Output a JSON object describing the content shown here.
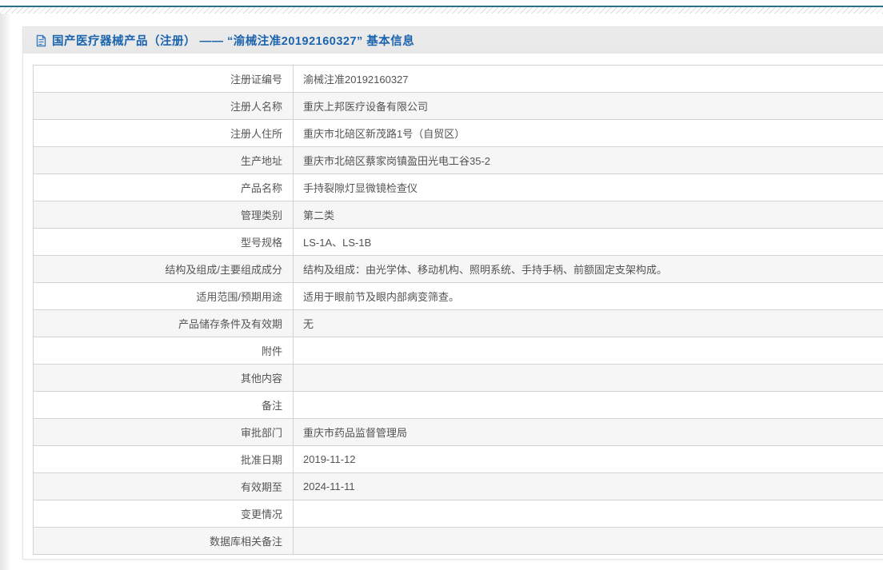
{
  "header": {
    "title": "国产医疗器械产品（注册） —— “渝械注准20192160327” 基本信息",
    "icon": "document-icon"
  },
  "colors": {
    "top_rule": "#2b6e8a",
    "title_blue": "#1b64ae",
    "header_bg": "#e9e9e9",
    "row_stripe": "#f6f6f6",
    "table_border": "#d4d4d4",
    "text": "#555555"
  },
  "table": {
    "rows": [
      {
        "label": "注册证编号",
        "value": "渝械注准20192160327"
      },
      {
        "label": "注册人名称",
        "value": "重庆上邦医疗设备有限公司"
      },
      {
        "label": "注册人住所",
        "value": "重庆市北碚区新茂路1号（自贸区）"
      },
      {
        "label": "生产地址",
        "value": "重庆市北碚区蔡家岗镇盈田光电工谷35-2"
      },
      {
        "label": "产品名称",
        "value": "手持裂隙灯显微镜检查仪"
      },
      {
        "label": "管理类别",
        "value": "第二类"
      },
      {
        "label": "型号规格",
        "value": "LS-1A、LS-1B"
      },
      {
        "label": "结构及组成/主要组成成分",
        "value": "结构及组成：由光学体、移动机构、照明系统、手持手柄、前额固定支架构成。"
      },
      {
        "label": "适用范围/预期用途",
        "value": "适用于眼前节及眼内部病变筛查。"
      },
      {
        "label": "产品储存条件及有效期",
        "value": "无"
      },
      {
        "label": "附件",
        "value": ""
      },
      {
        "label": "其他内容",
        "value": ""
      },
      {
        "label": "备注",
        "value": ""
      },
      {
        "label": "审批部门",
        "value": "重庆市药品监督管理局"
      },
      {
        "label": "批准日期",
        "value": "2019-11-12"
      },
      {
        "label": "有效期至",
        "value": "2024-11-11"
      },
      {
        "label": "变更情况",
        "value": ""
      },
      {
        "label": "数据库相关备注",
        "value": ""
      }
    ]
  }
}
